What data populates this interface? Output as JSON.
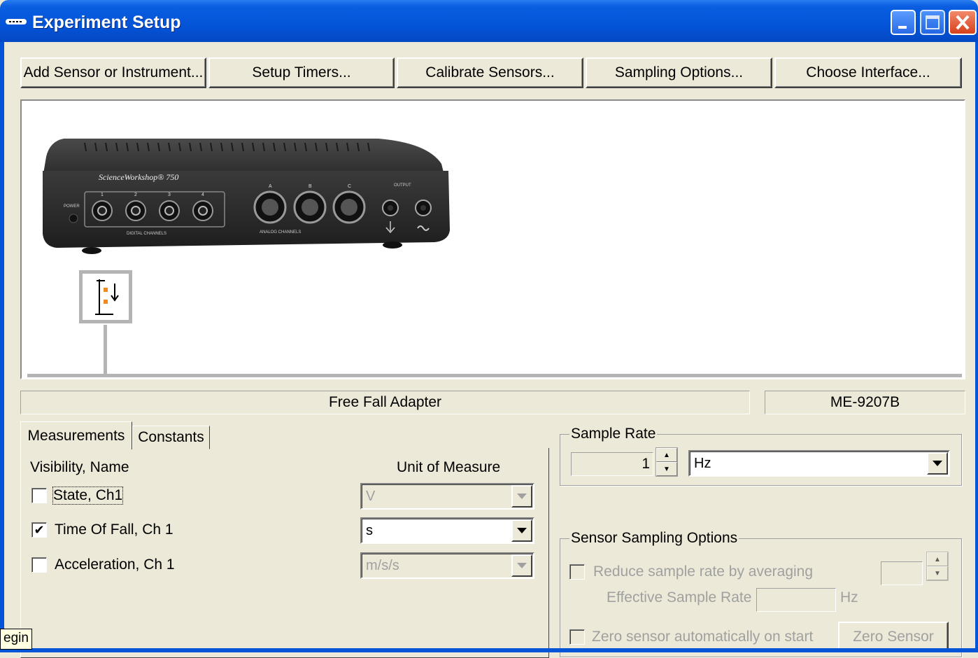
{
  "window": {
    "title": "Experiment Setup"
  },
  "toolbar": {
    "add_sensor": "Add Sensor or Instrument...",
    "setup_timers": "Setup Timers...",
    "calibrate_sensors": "Calibrate Sensors...",
    "sampling_options": "Sampling Options...",
    "choose_interface": "Choose Interface..."
  },
  "interface_device": {
    "brand": "ScienceWorkshop® 750",
    "digital_label": "DIGITAL CHANNELS",
    "analog_label": "ANALOG CHANNELS",
    "power_label": "POWER",
    "output_label": "OUTPUT",
    "digital_channels": [
      "1",
      "2",
      "3",
      "4"
    ],
    "analog_channels": [
      "A",
      "B",
      "C"
    ]
  },
  "sensor": {
    "name": "Free Fall Adapter",
    "model": "ME-9207B"
  },
  "tabs": [
    {
      "label": "Measurements",
      "active": true
    },
    {
      "label": "Constants",
      "active": false
    }
  ],
  "measurements": {
    "col_visibility": "Visibility, Name",
    "col_unit": "Unit of Measure",
    "rows": [
      {
        "name": "State, Ch1",
        "checked": false,
        "unit": "V",
        "enabled": false
      },
      {
        "name": "Time Of Fall, Ch 1",
        "checked": true,
        "unit": "s",
        "enabled": true
      },
      {
        "name": "Acceleration, Ch 1",
        "checked": false,
        "unit": "m/s/s",
        "enabled": false
      }
    ]
  },
  "sample_rate": {
    "label": "Sample Rate",
    "value": "1",
    "unit": "Hz"
  },
  "sensor_sampling": {
    "label": "Sensor Sampling Options",
    "reduce_label": "Reduce sample rate by averaging",
    "effective_label": "Effective Sample Rate",
    "effective_unit": "Hz",
    "zero_auto_label": "Zero sensor automatically on start",
    "zero_button": "Zero Sensor"
  },
  "tooltip": {
    "text": "egin"
  }
}
